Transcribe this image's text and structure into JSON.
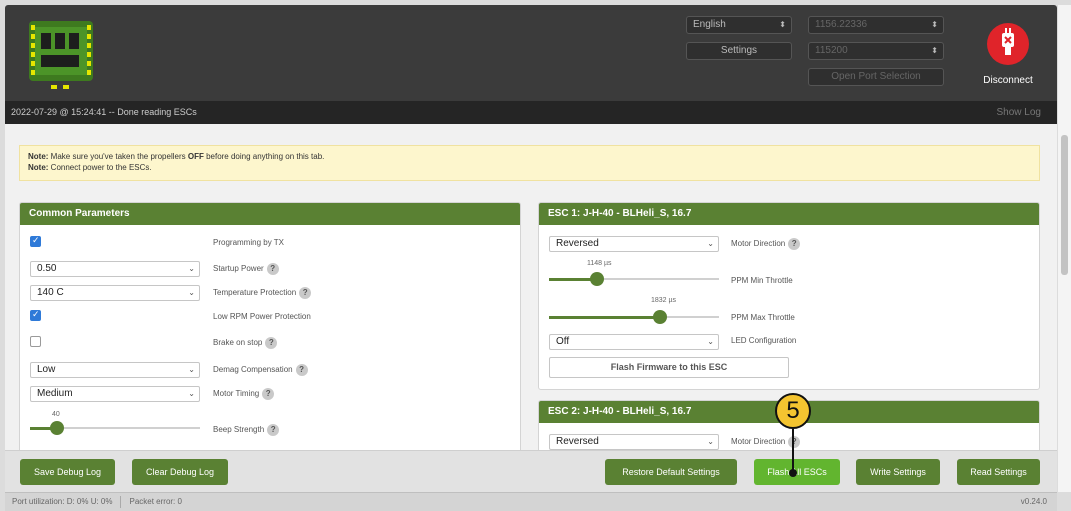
{
  "header": {
    "language": "English",
    "settings_label": "Settings",
    "port": "1156.22336",
    "baud": "115200",
    "open_port_label": "Open Port Selection",
    "disconnect_label": "Disconnect"
  },
  "logbar": {
    "message": "2022-07-29 @ 15:24:41 -- Done reading ESCs",
    "show_log": "Show Log"
  },
  "note": {
    "line1_prefix": "Note:",
    "line1_a": " Make sure you've taken the propellers ",
    "line1_bold": "OFF",
    "line1_b": " before doing anything on this tab.",
    "line2_prefix": "Note:",
    "line2": " Connect power to the ESCs."
  },
  "common": {
    "title": "Common Parameters",
    "programming_by_tx": "Programming by TX",
    "startup_power_value": "0.50",
    "startup_power": "Startup Power",
    "temp_value": "140 C",
    "temp_protection": "Temperature Protection",
    "low_rpm": "Low RPM Power Protection",
    "brake_on_stop": "Brake on stop",
    "demag_value": "Low",
    "demag": "Demag Compensation",
    "timing_value": "Medium",
    "motor_timing": "Motor Timing",
    "beep_value": "40",
    "beep_strength": "Beep Strength",
    "programming_checked": true,
    "low_rpm_checked": true,
    "brake_checked": false
  },
  "esc1": {
    "title": "ESC 1: J-H-40 - BLHeli_S, 16.7",
    "direction_value": "Reversed",
    "motor_direction": "Motor Direction",
    "min_value": "1148 µs",
    "min_label": "PPM Min Throttle",
    "max_value": "1832 µs",
    "max_label": "PPM Max Throttle",
    "led_value": "Off",
    "led_label": "LED Configuration",
    "flash_label": "Flash Firmware to this ESC",
    "min_fraction": 0.28,
    "max_fraction": 0.65
  },
  "esc2": {
    "title": "ESC 2: J-H-40 - BLHeli_S, 16.7",
    "direction_value": "Reversed",
    "motor_direction": "Motor Direction"
  },
  "footer": {
    "save_debug": "Save Debug Log",
    "clear_debug": "Clear Debug Log",
    "restore_defaults": "Restore Default Settings",
    "flash_all": "Flash All ESCs",
    "write_settings": "Write Settings",
    "read_settings": "Read Settings"
  },
  "status": {
    "port_util": "Port utilization: D: 0% U: 0%",
    "packet_error": "Packet error: 0",
    "version": "v0.24.0"
  },
  "annotation": {
    "number": "5"
  },
  "colors": {
    "accent": "#5a8133",
    "active": "#62b52f",
    "disconnect": "#e0242a",
    "annotation": "#f4c430"
  }
}
